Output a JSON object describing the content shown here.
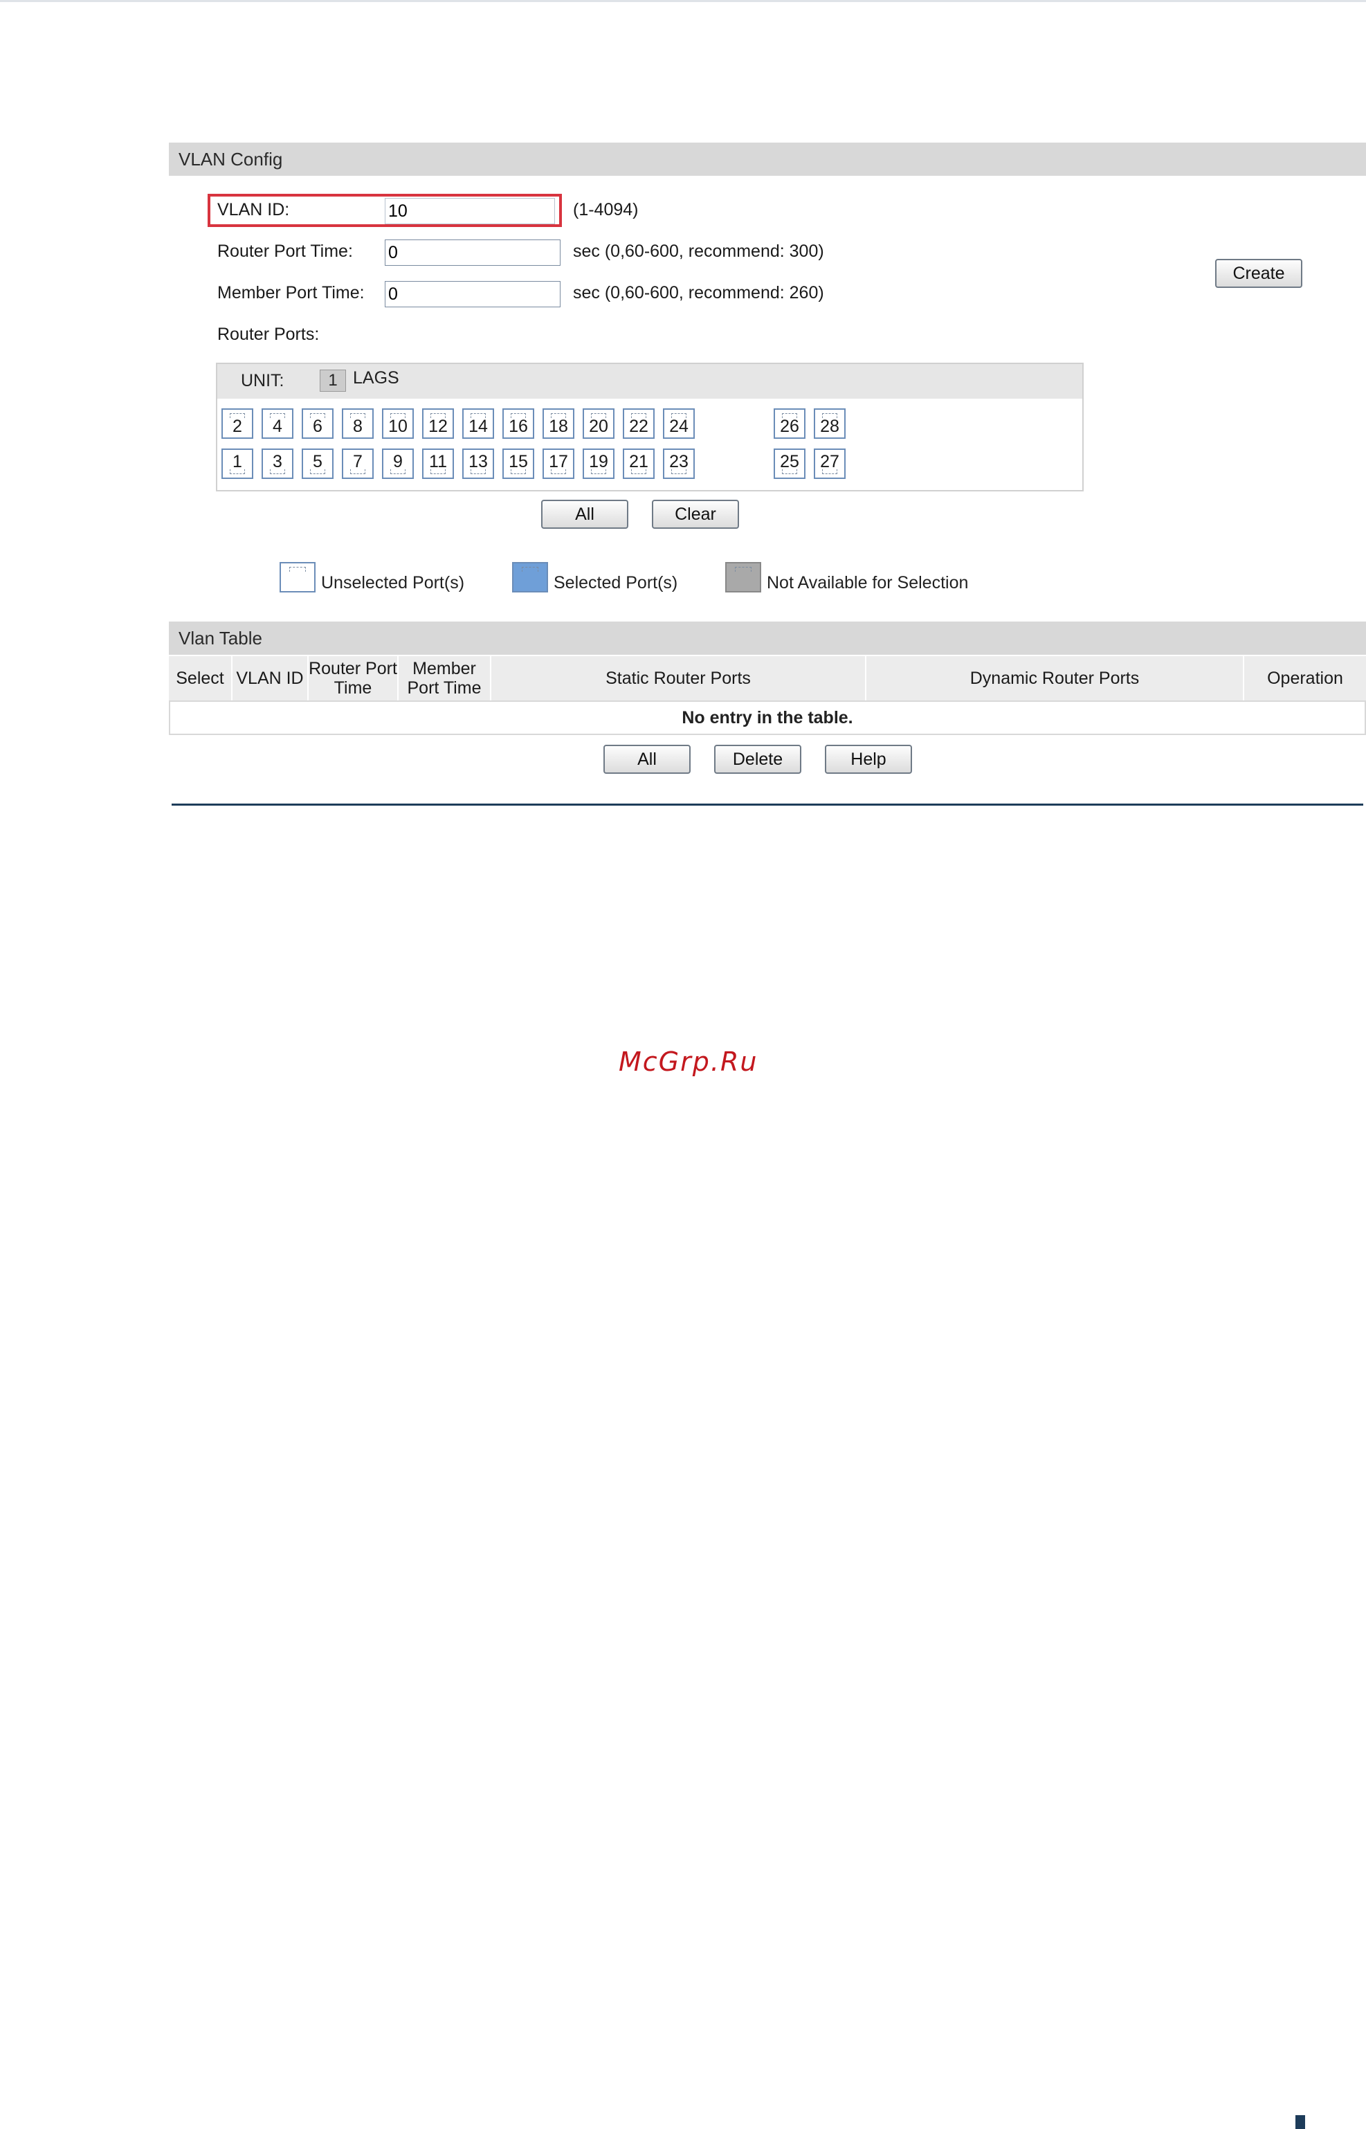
{
  "vlan_config": {
    "title": "VLAN Config",
    "vlan_id": {
      "label": "VLAN ID:",
      "value": "10",
      "hint": "(1-4094)"
    },
    "router_port_time": {
      "label": "Router Port Time:",
      "value": "0",
      "hint": "sec (0,60-600, recommend: 300)"
    },
    "member_port_time": {
      "label": "Member Port Time:",
      "value": "0",
      "hint": "sec (0,60-600, recommend: 260)"
    },
    "router_ports_label": "Router Ports:",
    "create_label": "Create",
    "unit": {
      "label": "UNIT:",
      "unit_number": "1",
      "lags_label": "LAGS"
    },
    "ports_top": [
      "2",
      "4",
      "6",
      "8",
      "10",
      "12",
      "14",
      "16",
      "18",
      "20",
      "22",
      "24",
      "26",
      "28"
    ],
    "ports_bottom": [
      "1",
      "3",
      "5",
      "7",
      "9",
      "11",
      "13",
      "15",
      "17",
      "19",
      "21",
      "23",
      "25",
      "27"
    ],
    "all_label": "All",
    "clear_label": "Clear",
    "legend": {
      "unselected": {
        "label": "Unselected Port(s)",
        "color": "#ffffff"
      },
      "selected": {
        "label": "Selected Port(s)",
        "color": "#6f9fd8"
      },
      "not_available": {
        "label": "Not Available for Selection",
        "color": "#a9a9a9"
      }
    }
  },
  "vlan_table": {
    "title": "Vlan Table",
    "columns": [
      "Select",
      "VLAN ID",
      "Router Port Time",
      "Member Port Time",
      "Static Router Ports",
      "Dynamic Router Ports",
      "Operation"
    ],
    "empty_message": "No entry in the table.",
    "all_label": "All",
    "delete_label": "Delete",
    "help_label": "Help"
  },
  "watermark": "McGrp.Ru"
}
